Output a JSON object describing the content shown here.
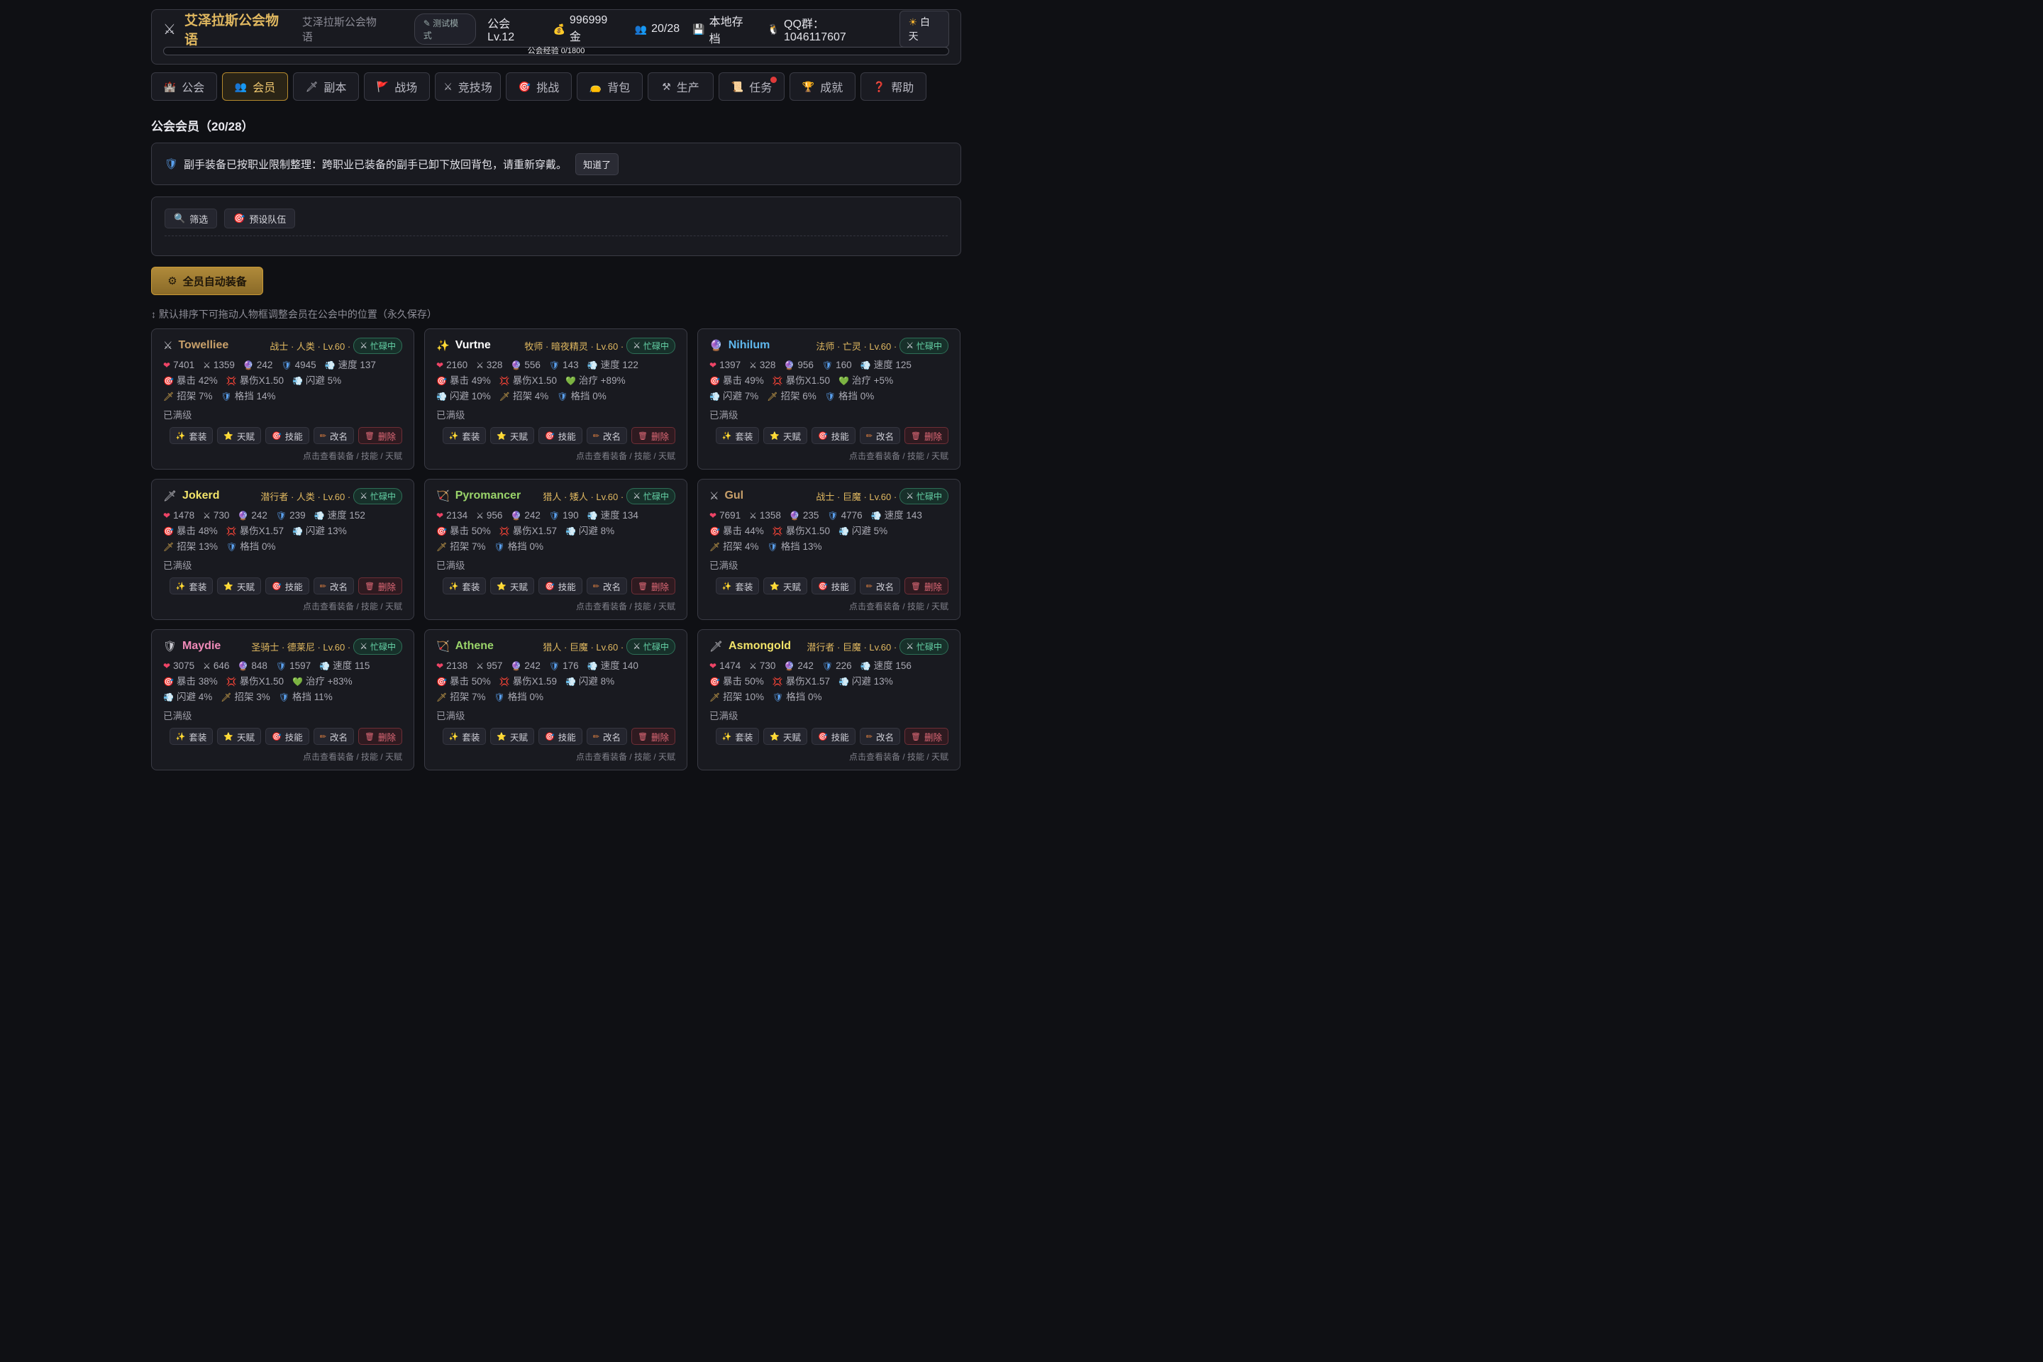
{
  "header": {
    "title": "艾泽拉斯公会物语",
    "subtitle": "艾泽拉斯公会物语",
    "test_mode": "测试模式",
    "guild_level": "公会 Lv.12",
    "gold": "996999 金",
    "members": "20/28",
    "save": "本地存档",
    "qq": "QQ群：1046117607",
    "daytime": "白天",
    "xp": "公会经验 0/1800"
  },
  "tabs": [
    {
      "label": "公会",
      "icon": "castle-icon"
    },
    {
      "label": "会员",
      "icon": "members-icon"
    },
    {
      "label": "副本",
      "icon": "dagger-icon"
    },
    {
      "label": "战场",
      "icon": "flag-icon"
    },
    {
      "label": "竞技场",
      "icon": "swords-icon"
    },
    {
      "label": "挑战",
      "icon": "target-icon"
    },
    {
      "label": "背包",
      "icon": "bag-icon"
    },
    {
      "label": "生产",
      "icon": "tools-icon"
    },
    {
      "label": "任务",
      "icon": "scroll-icon"
    },
    {
      "label": "成就",
      "icon": "trophy-icon"
    },
    {
      "label": "帮助",
      "icon": "question-icon"
    }
  ],
  "section_title": "公会会员（20/28）",
  "notice": {
    "text": "副手装备已按职业限制整理：跨职业已装备的副手已卸下放回背包，请重新穿戴。",
    "button": "知道了"
  },
  "filters": {
    "filter": "筛选",
    "preset": "预设队伍"
  },
  "auto_equip": "全员自动装备",
  "hint": "↕ 默认排序下可拖动人物框调整会员在公会中的位置（永久保存）",
  "card_common": {
    "maxed": "已满级",
    "busy": "忙碌中",
    "btn_set": "套装",
    "btn_talent": "天赋",
    "btn_skill": "技能",
    "btn_rename": "改名",
    "btn_delete": "删除",
    "footer": "点击查看装备 / 技能 / 天赋"
  },
  "colors": {
    "gold": "#e0b860",
    "accent_border": "#b58a2e",
    "busy_green": "#66d4a8",
    "delete_red": "#e26a78"
  },
  "members": [
    {
      "name": "Towelliee",
      "color": "#c8a06a",
      "icon": "swords-icon",
      "icon_glyph": "⚔",
      "cls": "战士 · 人类 · Lv.60 ·",
      "row1": [
        "7401",
        "1359",
        "242",
        "4945",
        "速度 137"
      ],
      "row2": [
        "暴击 42%",
        "暴伤X1.50",
        "闪避 5%"
      ],
      "row3": [
        "招架 7%",
        "格挡 14%"
      ],
      "r2icons": [
        "crit",
        "critdmg",
        "dodge"
      ],
      "r3icons": [
        "parry",
        "block"
      ]
    },
    {
      "name": "Vurtne",
      "color": "#ffffff",
      "icon": "sparkle-icon",
      "icon_glyph": "✨",
      "cls": "牧师 · 暗夜精灵 · Lv.60 ·",
      "row1": [
        "2160",
        "328",
        "556",
        "143",
        "速度 122"
      ],
      "row2": [
        "暴击 49%",
        "暴伤X1.50",
        "治疗 +89%"
      ],
      "row3": [
        "闪避 10%",
        "招架 4%",
        "格挡 0%"
      ],
      "r2icons": [
        "crit",
        "critdmg",
        "heal"
      ],
      "r3icons": [
        "dodge",
        "parry",
        "block"
      ]
    },
    {
      "name": "Nihilum",
      "color": "#5fb8ee",
      "icon": "mage-icon",
      "icon_glyph": "🔮",
      "cls": "法师 · 亡灵 · Lv.60 ·",
      "row1": [
        "1397",
        "328",
        "956",
        "160",
        "速度 125"
      ],
      "row2": [
        "暴击 49%",
        "暴伤X1.50",
        "治疗 +5%"
      ],
      "row3": [
        "闪避 7%",
        "招架 6%",
        "格挡 0%"
      ],
      "r2icons": [
        "crit",
        "critdmg",
        "heal"
      ],
      "r3icons": [
        "dodge",
        "parry",
        "block"
      ]
    },
    {
      "name": "Jokerd",
      "color": "#f2e46a",
      "icon": "dagger-icon",
      "icon_glyph": "🗡",
      "cls": "潜行者 · 人类 · Lv.60 ·",
      "row1": [
        "1478",
        "730",
        "242",
        "239",
        "速度 152"
      ],
      "row2": [
        "暴击 48%",
        "暴伤X1.57",
        "闪避 13%"
      ],
      "row3": [
        "招架 13%",
        "格挡 0%"
      ],
      "r2icons": [
        "crit",
        "critdmg",
        "dodge"
      ],
      "r3icons": [
        "parry",
        "block"
      ]
    },
    {
      "name": "Pyromancer",
      "color": "#9ad46a",
      "icon": "bow-icon",
      "icon_glyph": "🏹",
      "cls": "猎人 · 矮人 · Lv.60 ·",
      "row1": [
        "2134",
        "956",
        "242",
        "190",
        "速度 134"
      ],
      "row2": [
        "暴击 50%",
        "暴伤X1.57",
        "闪避 8%"
      ],
      "row3": [
        "招架 7%",
        "格挡 0%"
      ],
      "r2icons": [
        "crit",
        "critdmg",
        "dodge"
      ],
      "r3icons": [
        "parry",
        "block"
      ]
    },
    {
      "name": "Gul",
      "color": "#c8a06a",
      "icon": "swords-icon",
      "icon_glyph": "⚔",
      "cls": "战士 · 巨魔 · Lv.60 ·",
      "row1": [
        "7691",
        "1358",
        "235",
        "4776",
        "速度 143"
      ],
      "row2": [
        "暴击 44%",
        "暴伤X1.50",
        "闪避 5%"
      ],
      "row3": [
        "招架 4%",
        "格挡 13%"
      ],
      "r2icons": [
        "crit",
        "critdmg",
        "dodge"
      ],
      "r3icons": [
        "parry",
        "block"
      ]
    },
    {
      "name": "Maydie",
      "color": "#f08ab8",
      "icon": "shield-icon",
      "icon_glyph": "🛡",
      "cls": "圣骑士 · 德莱尼 · Lv.60 ·",
      "row1": [
        "3075",
        "646",
        "848",
        "1597",
        "速度 115"
      ],
      "row2": [
        "暴击 38%",
        "暴伤X1.50",
        "治疗 +83%"
      ],
      "row3": [
        "闪避 4%",
        "招架 3%",
        "格挡 11%"
      ],
      "r2icons": [
        "crit",
        "critdmg",
        "heal"
      ],
      "r3icons": [
        "dodge",
        "parry",
        "block"
      ]
    },
    {
      "name": "Athene",
      "color": "#9ad46a",
      "icon": "bow-icon",
      "icon_glyph": "🏹",
      "cls": "猎人 · 巨魔 · Lv.60 ·",
      "row1": [
        "2138",
        "957",
        "242",
        "176",
        "速度 140"
      ],
      "row2": [
        "暴击 50%",
        "暴伤X1.59",
        "闪避 8%"
      ],
      "row3": [
        "招架 7%",
        "格挡 0%"
      ],
      "r2icons": [
        "crit",
        "critdmg",
        "dodge"
      ],
      "r3icons": [
        "parry",
        "block"
      ]
    },
    {
      "name": "Asmongold",
      "color": "#f2e46a",
      "icon": "dagger-icon",
      "icon_glyph": "🗡",
      "cls": "潜行者 · 巨魔 · Lv.60 ·",
      "row1": [
        "1474",
        "730",
        "242",
        "226",
        "速度 156"
      ],
      "row2": [
        "暴击 50%",
        "暴伤X1.57",
        "闪避 13%"
      ],
      "row3": [
        "招架 10%",
        "格挡 0%"
      ],
      "r2icons": [
        "crit",
        "critdmg",
        "dodge"
      ],
      "r3icons": [
        "parry",
        "block"
      ]
    }
  ]
}
